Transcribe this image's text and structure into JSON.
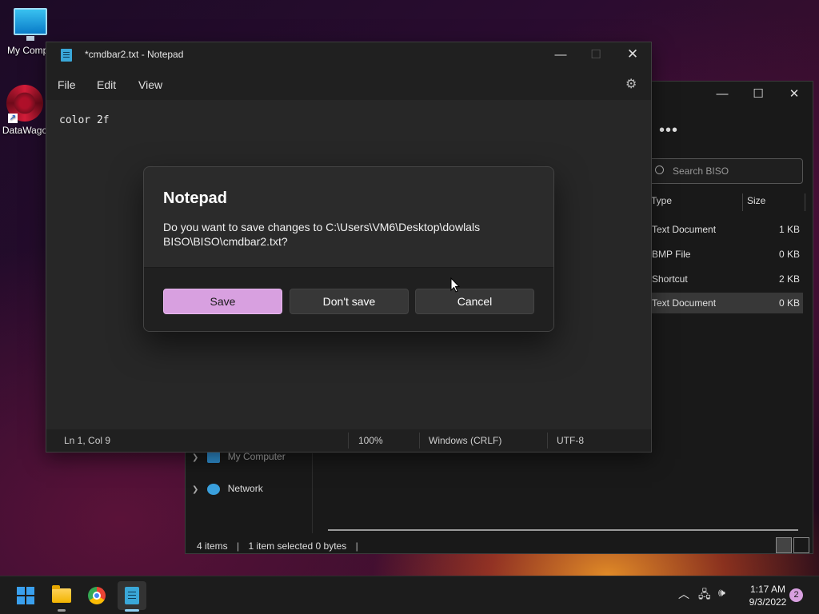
{
  "desktop": {
    "icons": [
      {
        "label": "My Compu",
        "icon": "computer-icon"
      },
      {
        "label": "DataWago",
        "icon": "datawagon-icon"
      }
    ]
  },
  "explorer": {
    "more_label": "•••",
    "search_placeholder": "Search BISO",
    "columns": {
      "type": "Type",
      "size": "Size"
    },
    "rows": [
      {
        "type": "Text Document",
        "size": "1 KB"
      },
      {
        "type": "BMP File",
        "size": "0 KB"
      },
      {
        "type": "Shortcut",
        "size": "2 KB"
      },
      {
        "type": "Text Document",
        "size": "0 KB",
        "selected": true
      }
    ],
    "nav": [
      {
        "label": "My Computer"
      },
      {
        "label": "Network"
      }
    ],
    "status": {
      "items": "4 items",
      "selection": "1 item selected  0 bytes"
    }
  },
  "notepad": {
    "title": "*cmdbar2.txt - Notepad",
    "menu": [
      "File",
      "Edit",
      "View"
    ],
    "content": "color 2f",
    "status": {
      "position": "Ln 1, Col 9",
      "zoom": "100%",
      "line_ending": "Windows (CRLF)",
      "encoding": "UTF-8"
    }
  },
  "dialog": {
    "title": "Notepad",
    "message": "Do you want to save changes to C:\\Users\\VM6\\Desktop\\dowlals BISO\\BISO\\cmdbar2.txt?",
    "buttons": {
      "save": "Save",
      "dont_save": "Don't save",
      "cancel": "Cancel"
    }
  },
  "taskbar": {
    "apps": [
      "start-icon",
      "file-explorer-icon",
      "chrome-icon",
      "notepad-icon"
    ],
    "clock": {
      "time": "1:17 AM",
      "date": "9/3/2022"
    },
    "notification_count": "2"
  },
  "colors": {
    "accent": "#d8a0e0",
    "window_bg": "#202020",
    "dialog_bg": "#2b2b2b"
  }
}
